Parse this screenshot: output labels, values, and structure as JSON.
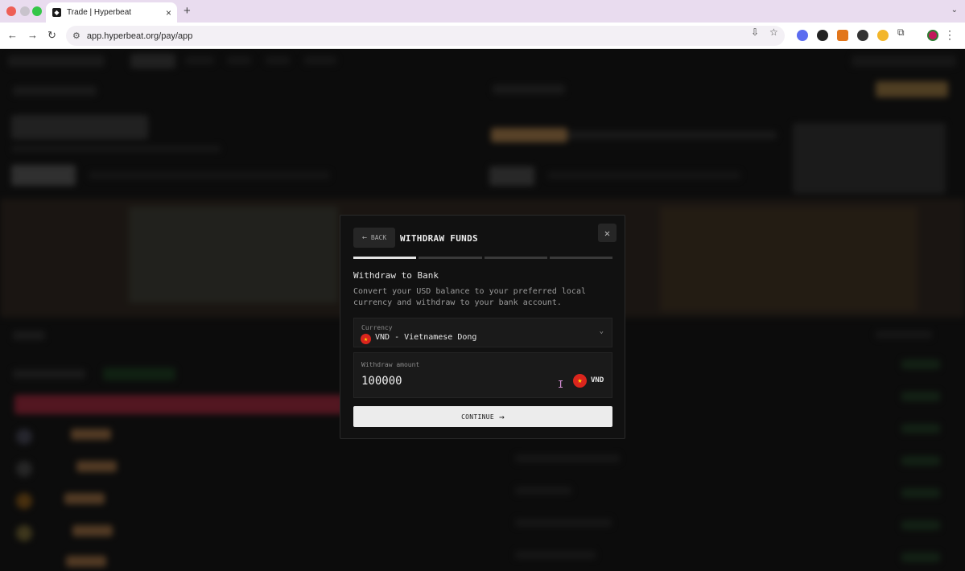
{
  "browser": {
    "tab_title": "Trade | Hyperbeat",
    "tab_close": "×",
    "new_tab": "+",
    "url": "app.hyperbeat.org/pay/app"
  },
  "icons": {
    "back": "←",
    "forward": "→",
    "reload": "↻",
    "url_tune": "⚙",
    "install": "⇩",
    "bookmark": "☆",
    "extensions": "⧉",
    "kebab": "⋮",
    "tab_menu": "⌄",
    "modal_back": "←",
    "close": "✕",
    "chevron": "⌄",
    "continue_arrow": "→",
    "ibeam": "I",
    "flag_star": "★"
  },
  "modal": {
    "back_label": "BACK",
    "title": "WITHDRAW FUNDS",
    "steps": [
      {
        "active": true
      },
      {
        "active": false
      },
      {
        "active": false
      },
      {
        "active": false
      }
    ],
    "section_title": "Withdraw to Bank",
    "description": "Convert your USD balance to your preferred local currency and withdraw to your bank account.",
    "currency": {
      "label": "Currency",
      "value": "VND - Vietnamese Dong"
    },
    "amount": {
      "label": "Withdraw amount",
      "value": "100000",
      "unit": "VND"
    },
    "continue_label": "CONTINUE"
  },
  "colors": {
    "flag_red": "#da251d",
    "flag_star": "#ffdf00",
    "progress_active": "#e4e4e4",
    "progress_inactive": "#3a3a3a"
  }
}
